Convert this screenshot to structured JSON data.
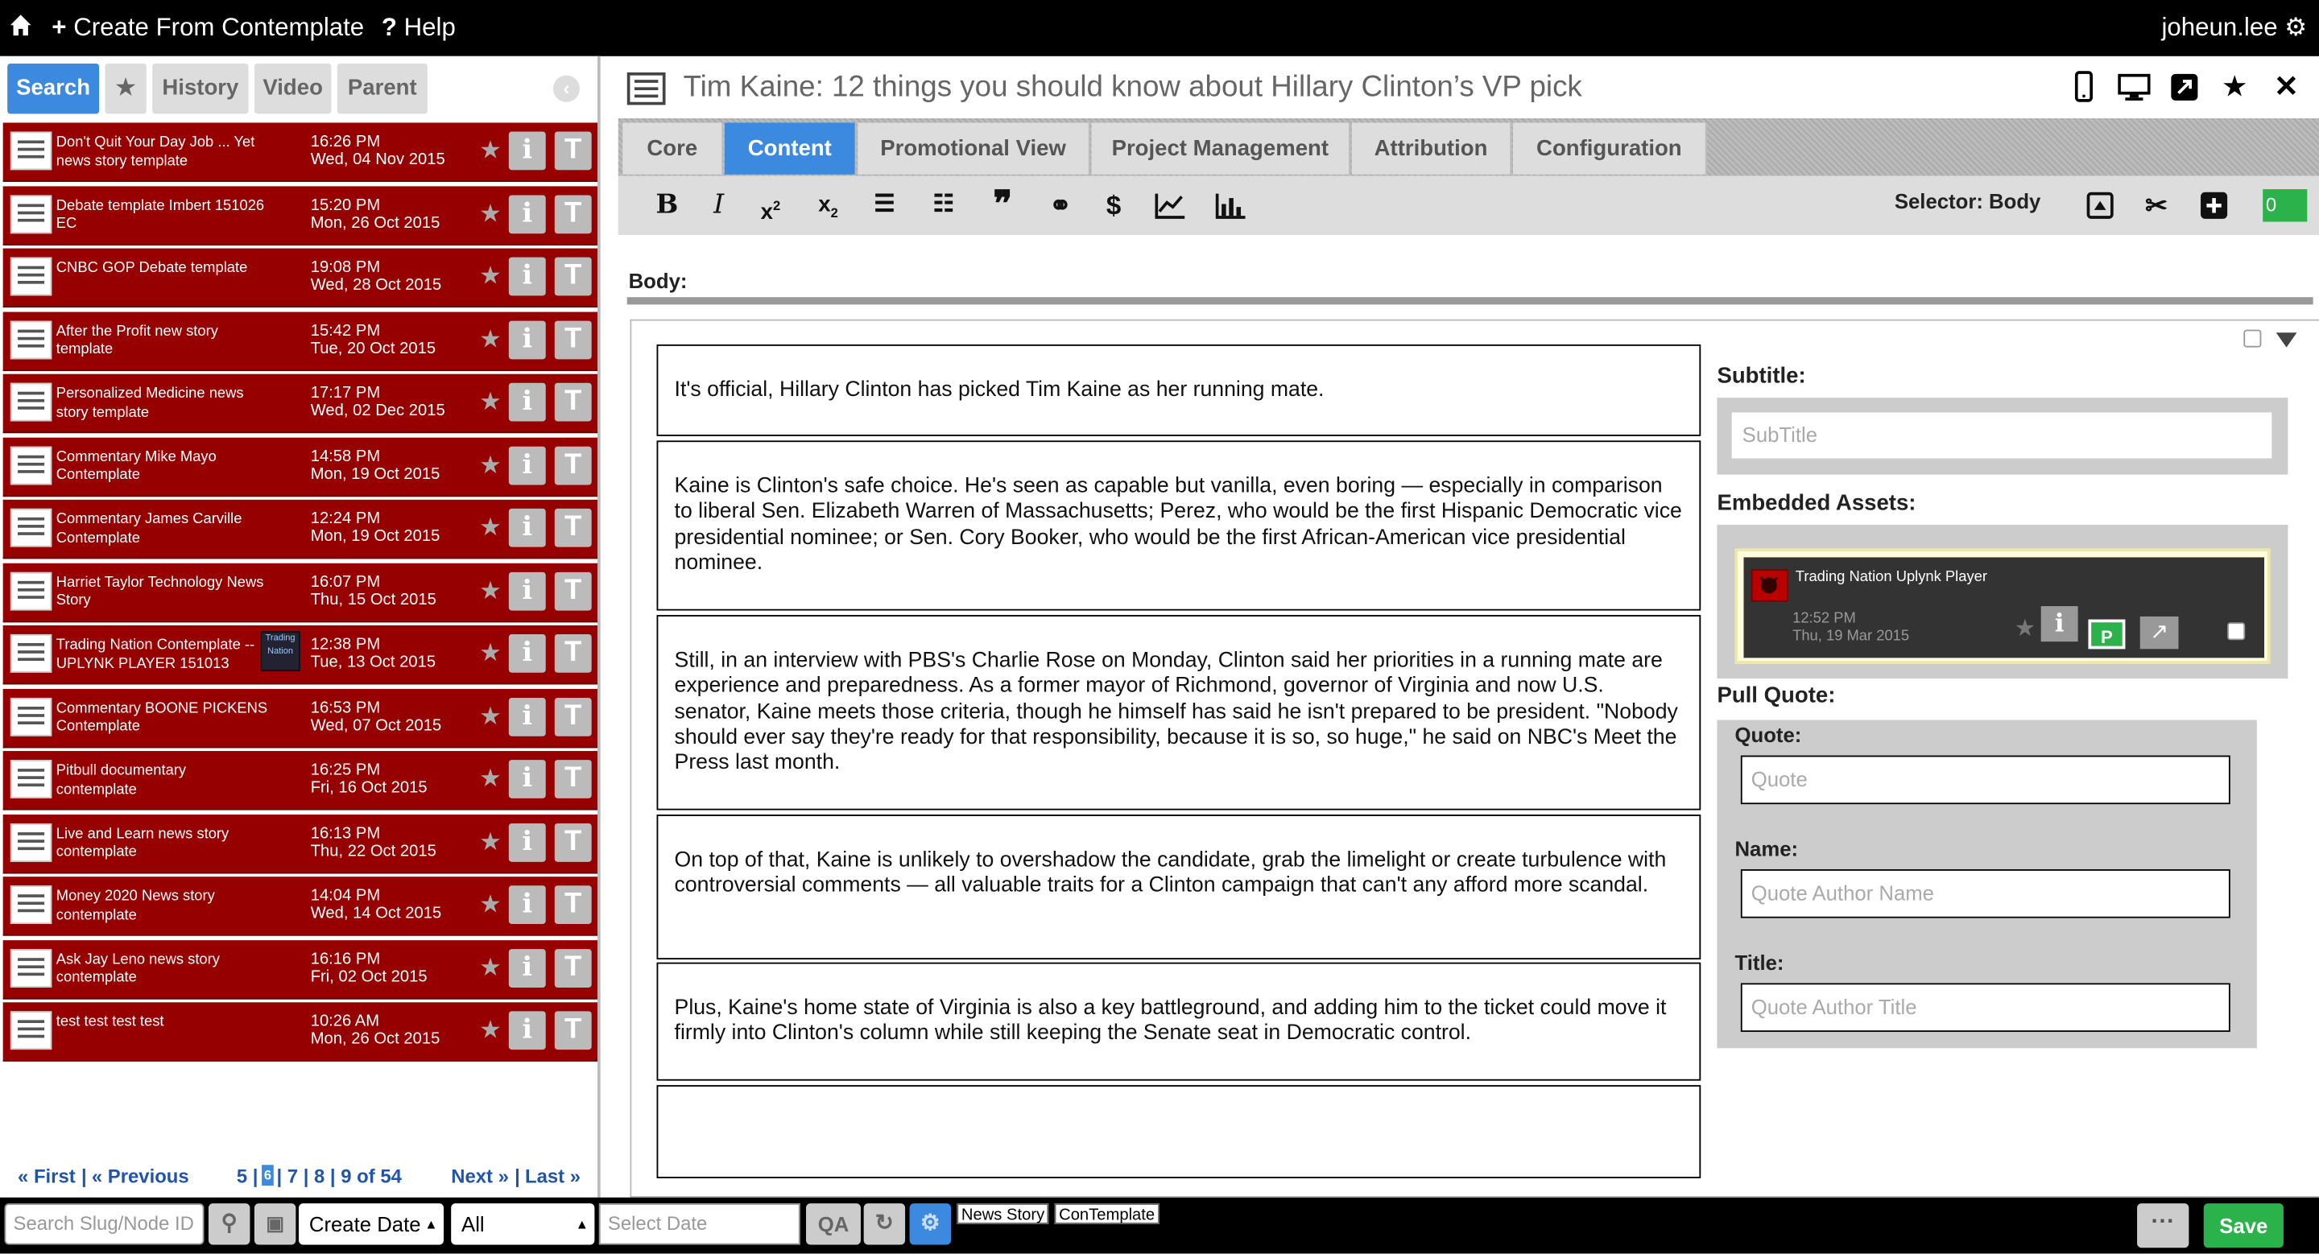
{
  "topbar": {
    "create_label": "Create From Contemplate",
    "help_label": "Help",
    "user": "joheun.lee"
  },
  "left_tabs": [
    "Search",
    "★",
    "History",
    "Video",
    "Parent"
  ],
  "items": [
    {
      "name": "Don't Quit Your Day Job ... Yet news story template",
      "time": "16:26 PM",
      "date": "Wed, 04 Nov 2015"
    },
    {
      "name": "Debate template Imbert 151026 EC",
      "time": "15:20 PM",
      "date": "Mon, 26 Oct 2015"
    },
    {
      "name": "CNBC GOP Debate template",
      "time": "19:08 PM",
      "date": "Wed, 28 Oct 2015"
    },
    {
      "name": "After the Profit new story template",
      "time": "15:42 PM",
      "date": "Tue, 20 Oct 2015"
    },
    {
      "name": "Personalized Medicine news story template",
      "time": "17:17 PM",
      "date": "Wed, 02 Dec 2015"
    },
    {
      "name": "Commentary Mike Mayo Contemplate",
      "time": "14:58 PM",
      "date": "Mon, 19 Oct 2015"
    },
    {
      "name": "Commentary James Carville Contemplate",
      "time": "12:24 PM",
      "date": "Mon, 19 Oct 2015"
    },
    {
      "name": "Harriet Taylor Technology News Story",
      "time": "16:07 PM",
      "date": "Thu, 15 Oct 2015"
    },
    {
      "name": "Trading Nation Contemplate -- UPLYNK PLAYER 151013",
      "time": "12:38 PM",
      "date": "Tue, 13 Oct 2015",
      "thumb": "Trading Nation"
    },
    {
      "name": "Commentary BOONE PICKENS Contemplate",
      "time": "16:53 PM",
      "date": "Wed, 07 Oct 2015"
    },
    {
      "name": "Pitbull documentary contemplate",
      "time": "16:25 PM",
      "date": "Fri, 16 Oct 2015"
    },
    {
      "name": "Live and Learn news story contemplate",
      "time": "16:13 PM",
      "date": "Thu, 22 Oct 2015"
    },
    {
      "name": "Money 2020 News story contemplate",
      "time": "14:04 PM",
      "date": "Wed, 14 Oct 2015"
    },
    {
      "name": "Ask Jay Leno news story contemplate",
      "time": "16:16 PM",
      "date": "Fri, 02 Oct 2015"
    },
    {
      "name": "test test test test",
      "time": "10:26 AM",
      "date": "Mon, 26 Oct 2015"
    }
  ],
  "pager": {
    "first": "« First",
    "previous": "« Previous",
    "pages_a": "5 |",
    "current": "6",
    "pages_b": "| 7 | 8 | 9 of 54",
    "next": "Next »",
    "last": "Last »"
  },
  "bottombar": {
    "search_placeholder": "Search Slug/Node ID",
    "sort_value": "Create Date",
    "filter_value": "All",
    "date_placeholder": "Select Date",
    "qa_label": "QA",
    "tags": [
      "News Story",
      "ConTemplate"
    ],
    "more_label": "···",
    "save_label": "Save"
  },
  "page_title": "Tim Kaine: 12 things you should know about Hillary Clinton’s VP pick",
  "main_tabs": [
    "Core",
    "Content",
    "Promotional View",
    "Project Management",
    "Attribution",
    "Configuration"
  ],
  "toolbar": {
    "selector": "Selector: Body",
    "counter": "0"
  },
  "body_label": "Body:",
  "paragraphs": [
    "It's official, Hillary Clinton has picked Tim Kaine as her running mate.",
    "Kaine is Clinton's safe choice. He's seen as capable but vanilla, even boring — especially in comparison to liberal Sen. Elizabeth Warren of Massachusetts; Perez, who would be the first Hispanic Democratic vice presidential nominee; or Sen. Cory Booker, who would be the first African-American vice presidential nominee.",
    "Still, in an interview with PBS's Charlie Rose on Monday, Clinton said her priorities in a running mate are experience and preparedness. As a former mayor of Richmond, governor of Virginia and now U.S. senator, Kaine meets those criteria, though he himself has said he isn't prepared to be president. \"Nobody should ever say they're ready for that responsibility, because it is so, so huge,\" he said on NBC's Meet the Press last month.",
    "On top of that, Kaine is unlikely to overshadow the candidate, grab the limelight or create turbulence with controversial comments — all valuable traits for a Clinton campaign that can't any afford more scandal.",
    "Plus, Kaine's home state of Virginia is also a key battleground, and adding him to the ticket could move it firmly into Clinton's column while still keeping the Senate seat in Democratic control.",
    ""
  ],
  "sidebar": {
    "subtitle_label": "Subtitle:",
    "subtitle_placeholder": "SubTitle",
    "assets_label": "Embedded Assets:",
    "asset": {
      "name": "Trading Nation Uplynk Player",
      "time": "12:52 PM",
      "date": "Thu, 19 Mar 2015",
      "p_label": "P"
    },
    "pullquote_label": "Pull Quote:",
    "quote_label": "Quote:",
    "quote_placeholder": "Quote",
    "name_label": "Name:",
    "name_placeholder": "Quote Author Name",
    "title_label": "Title:",
    "title_placeholder": "Quote Author Title"
  },
  "colors": {
    "accent": "#3b8ae0",
    "item_bg": "#960000",
    "save": "#2cb24a",
    "bar": "#000000"
  }
}
